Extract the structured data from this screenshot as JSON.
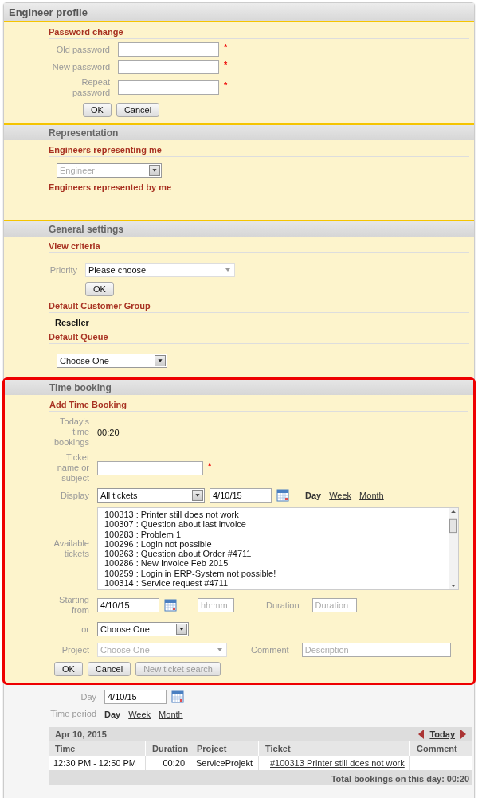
{
  "panel_title": "Engineer profile",
  "password_change": {
    "heading": "Password change",
    "fields": [
      {
        "label": "Old password",
        "required_mark": "*"
      },
      {
        "label": "New password",
        "required_mark": "*"
      },
      {
        "label": "Repeat password",
        "required_mark": "*"
      }
    ],
    "buttons": [
      "OK",
      "Cancel"
    ]
  },
  "representation": {
    "title": "Representation",
    "representing_heading": "Engineers representing me",
    "engineer_select": {
      "value": "Engineer",
      "disabled": true
    },
    "represented_heading": "Engineers represented by me"
  },
  "general_settings": {
    "title": "General settings",
    "view_criteria_heading": "View criteria",
    "priority_label": "Priority",
    "priority_value": "Please choose",
    "ok_button": "OK",
    "customer_group_heading": "Default Customer Group",
    "customer_group_value": "Reseller",
    "queue_heading": "Default Queue",
    "queue_value": "Choose One"
  },
  "time_booking": {
    "title": "Time booking",
    "highlighted": true,
    "heading": "Add Time Booking",
    "todays_label": "Today's time bookings",
    "todays_value": "00:20",
    "ticket_label": "Ticket name or subject",
    "ticket_required_mark": "*",
    "display_label": "Display",
    "display_value": "All tickets",
    "display_date": "4/10/15",
    "periods": [
      {
        "label": "Day",
        "selected": true
      },
      {
        "label": "Week",
        "selected": false
      },
      {
        "label": "Month",
        "selected": false
      }
    ],
    "available_label": "Available tickets",
    "tickets": [
      "100313 : Printer still does not work",
      "100307 : Question about last invoice",
      "100283 : Problem 1",
      "100296 : Login not possible",
      "100263 : Question about Order #4711",
      "100286 : New Invoice Feb 2015",
      "100259 : Login in ERP-System not possible!",
      "100314 : Service request #4711"
    ],
    "starting_label": "Starting from",
    "starting_date": "4/10/15",
    "time_placeholder": "hh:mm",
    "duration_label": "Duration",
    "duration_placeholder": "Duration",
    "or_label": "or",
    "or_value": "Choose One",
    "project_label": "Project",
    "project_select": {
      "value": "Choose One",
      "disabled": true
    },
    "comment_label": "Comment",
    "comment_placeholder": "Description",
    "buttons": [
      {
        "label": "OK",
        "disabled": false
      },
      {
        "label": "Cancel",
        "disabled": false
      },
      {
        "label": "New ticket search",
        "disabled": true
      }
    ]
  },
  "overview": {
    "day_label": "Day",
    "day_value": "4/10/15",
    "period_label": "Time period",
    "periods": [
      {
        "label": "Day",
        "selected": true
      },
      {
        "label": "Week",
        "selected": false
      },
      {
        "label": "Month",
        "selected": false
      }
    ],
    "table": {
      "date": "Apr 10, 2015",
      "today_link": "Today",
      "columns": [
        "Time",
        "Duration",
        "Project",
        "Ticket",
        "Comment"
      ],
      "rows": [
        {
          "time": "12:30 PM - 12:50 PM",
          "duration": "00:20",
          "project": "ServiceProjekt",
          "ticket": "#100313 Printer still does not work"
        }
      ],
      "total": "Total bookings on this day: 00:20"
    }
  }
}
